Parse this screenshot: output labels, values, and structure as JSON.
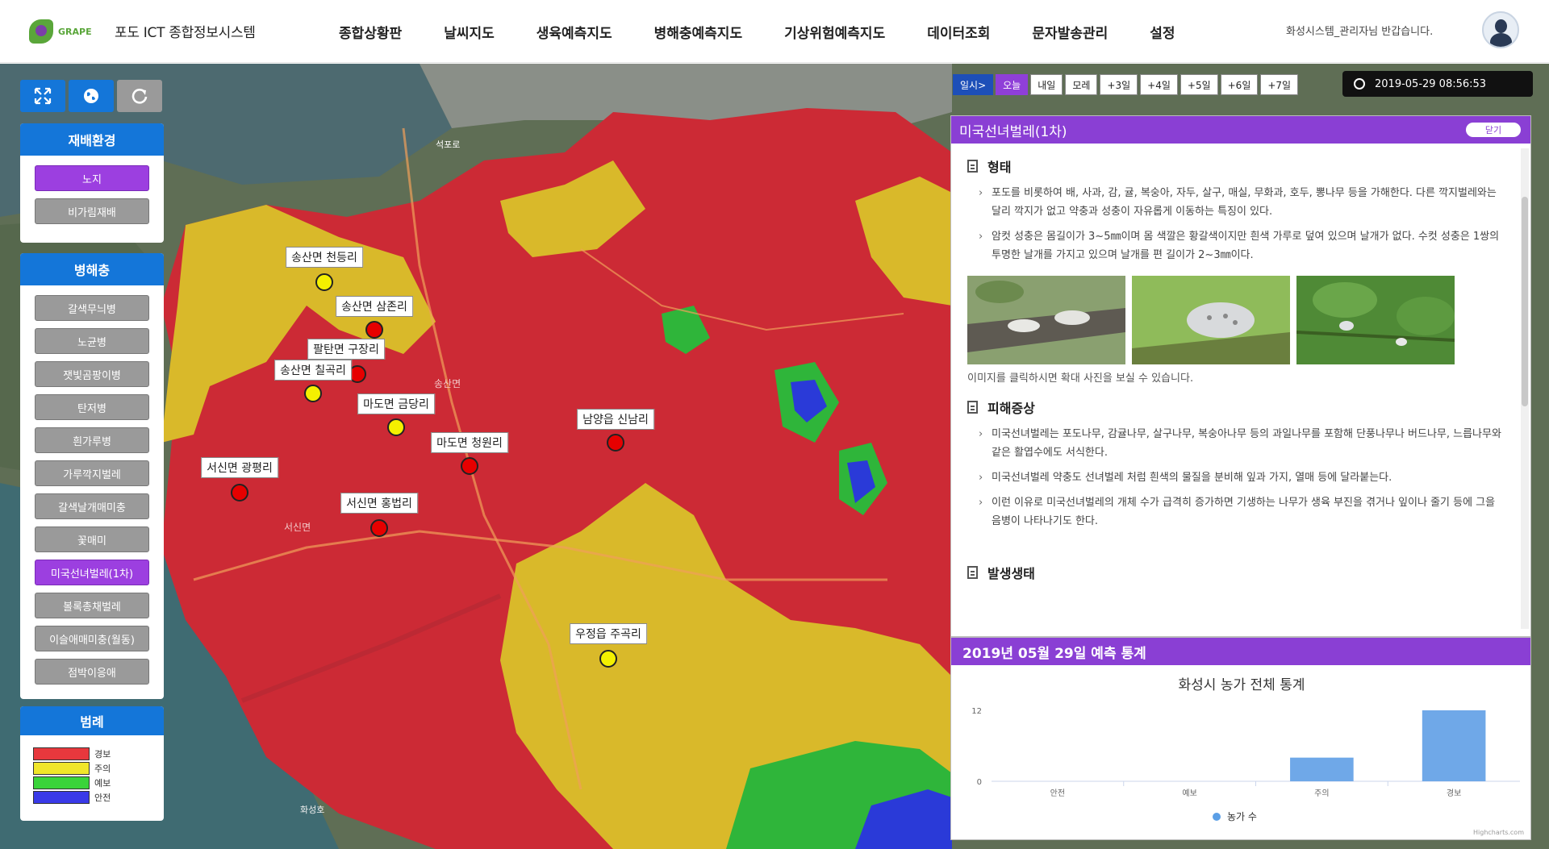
{
  "header": {
    "logo_alt": "logo",
    "title": "포도 ICT 종합정보시스템",
    "nav": [
      "종합상황판",
      "날씨지도",
      "생육예측지도",
      "병해충예측지도",
      "기상위험예측지도",
      "데이터조회",
      "문자발송관리",
      "설정"
    ],
    "greeting": "화성시스템_관리자님 반갑습니다."
  },
  "toolbar": {
    "fullscreen_icon": "expand-icon",
    "globe_icon": "globe-icon",
    "refresh_icon": "refresh-icon",
    "colors": [
      "#1476d9",
      "#1476d9",
      "#9a9a9a"
    ]
  },
  "left_panel": {
    "env_title": "재배환경",
    "env_items": [
      {
        "label": "노지",
        "active": true
      },
      {
        "label": "비가림재배",
        "active": false
      }
    ],
    "pest_title": "병해충",
    "pest_items": [
      {
        "label": "갈색무늬병",
        "active": false
      },
      {
        "label": "노균병",
        "active": false
      },
      {
        "label": "잿빛곰팡이병",
        "active": false
      },
      {
        "label": "탄저병",
        "active": false
      },
      {
        "label": "흰가루병",
        "active": false
      },
      {
        "label": "가루깍지벌레",
        "active": false
      },
      {
        "label": "갈색날개매미충",
        "active": false
      },
      {
        "label": "꽃매미",
        "active": false
      },
      {
        "label": "미국선녀벌레(1차)",
        "active": true
      },
      {
        "label": "볼록총채벌레",
        "active": false
      },
      {
        "label": "이슬애매미충(월동)",
        "active": false
      },
      {
        "label": "점박이응애",
        "active": false
      }
    ],
    "legend_title": "범례",
    "legend": [
      {
        "label": "경보",
        "color": "#e8383d"
      },
      {
        "label": "주의",
        "color": "#f0e62a"
      },
      {
        "label": "예보",
        "color": "#3ad43a"
      },
      {
        "label": "안전",
        "color": "#3a3ae8"
      }
    ]
  },
  "days": {
    "items": [
      "일시>",
      "오늘",
      "내일",
      "모레",
      "+3일",
      "+4일",
      "+5일",
      "+6일",
      "+7일"
    ],
    "selected": "오늘"
  },
  "clock": "2019-05-29 08:56:53",
  "map": {
    "labels": [
      "석포로",
      "화성호",
      "서신면",
      "송산면"
    ],
    "markers": [
      {
        "name": "송산면 천등리",
        "level": "주의"
      },
      {
        "name": "송산면 삼존리",
        "level": "경보"
      },
      {
        "name": "팔탄면 구장리",
        "level": "경보"
      },
      {
        "name": "송산면 칠곡리",
        "level": "주의"
      },
      {
        "name": "마도면 금당리",
        "level": "주의"
      },
      {
        "name": "남양읍 신남리",
        "level": "경보"
      },
      {
        "name": "마도면 청원리",
        "level": "경보"
      },
      {
        "name": "서신면 광평리",
        "level": "경보"
      },
      {
        "name": "서신면 홍법리",
        "level": "경보"
      },
      {
        "name": "우정읍 주곡리",
        "level": "주의"
      }
    ],
    "level_colors": {
      "경보": "#e60000",
      "주의": "#f4f000"
    }
  },
  "info": {
    "title": "미국선녀벌레(1차)",
    "close_label": "닫기",
    "section1_title": "형태",
    "section1_paras": [
      "포도를 비롯하여 배, 사과, 감, 귤, 복숭아, 자두, 살구, 매실, 무화과, 호두, 뽕나무 등을 가해한다. 다른 깍지벌레와는 달리 깍지가 없고 약충과 성충이 자유롭게 이동하는 특징이 있다.",
      "암컷 성충은 몸길이가 3~5㎜이며 몸 색깔은 황갈색이지만 흰색 가루로 덮여 있으며 날개가 없다. 수컷 성충은 1쌍의 투명한 날개를 가지고 있으며 날개를 편 길이가 2~3㎜이다."
    ],
    "photo_caption": "이미지를 클릭하시면 확대 사진을 보실 수 있습니다.",
    "section2_title": "피해증상",
    "section2_paras": [
      "미국선녀벌레는 포도나무, 감귤나무, 살구나무, 복숭아나무 등의 과일나무를 포함해 단풍나무나 버드나무, 느릅나무와 같은 활엽수에도 서식한다.",
      "미국선녀벌레 약충도 선녀벌레 처럼 흰색의 물질을 분비해 잎과 가지, 열매 등에 달라붙는다.",
      "이런 이유로 미국선녀벌레의 개체 수가 급격히 증가하면 기생하는 나무가 생육 부진을 겪거나 잎이나 줄기 등에 그을음병이 나타나기도 한다."
    ],
    "section3_title": "발생생태"
  },
  "stats": {
    "title": "2019년 05월 29일 예측 통계",
    "chart_title": "화성시 농가 전체 통계",
    "legend_label": "농가 수",
    "credit": "Highcharts.com"
  },
  "chart_data": {
    "type": "bar",
    "title": "화성시 농가 전체 통계",
    "categories": [
      "안전",
      "예보",
      "주의",
      "경보"
    ],
    "series": [
      {
        "name": "농가 수",
        "values": [
          0,
          0,
          4,
          12
        ]
      }
    ],
    "ylim": [
      0,
      12
    ],
    "yticks": [
      0,
      12
    ],
    "color": "#6fa8e8",
    "grid": false,
    "legend_position": "bottom"
  }
}
